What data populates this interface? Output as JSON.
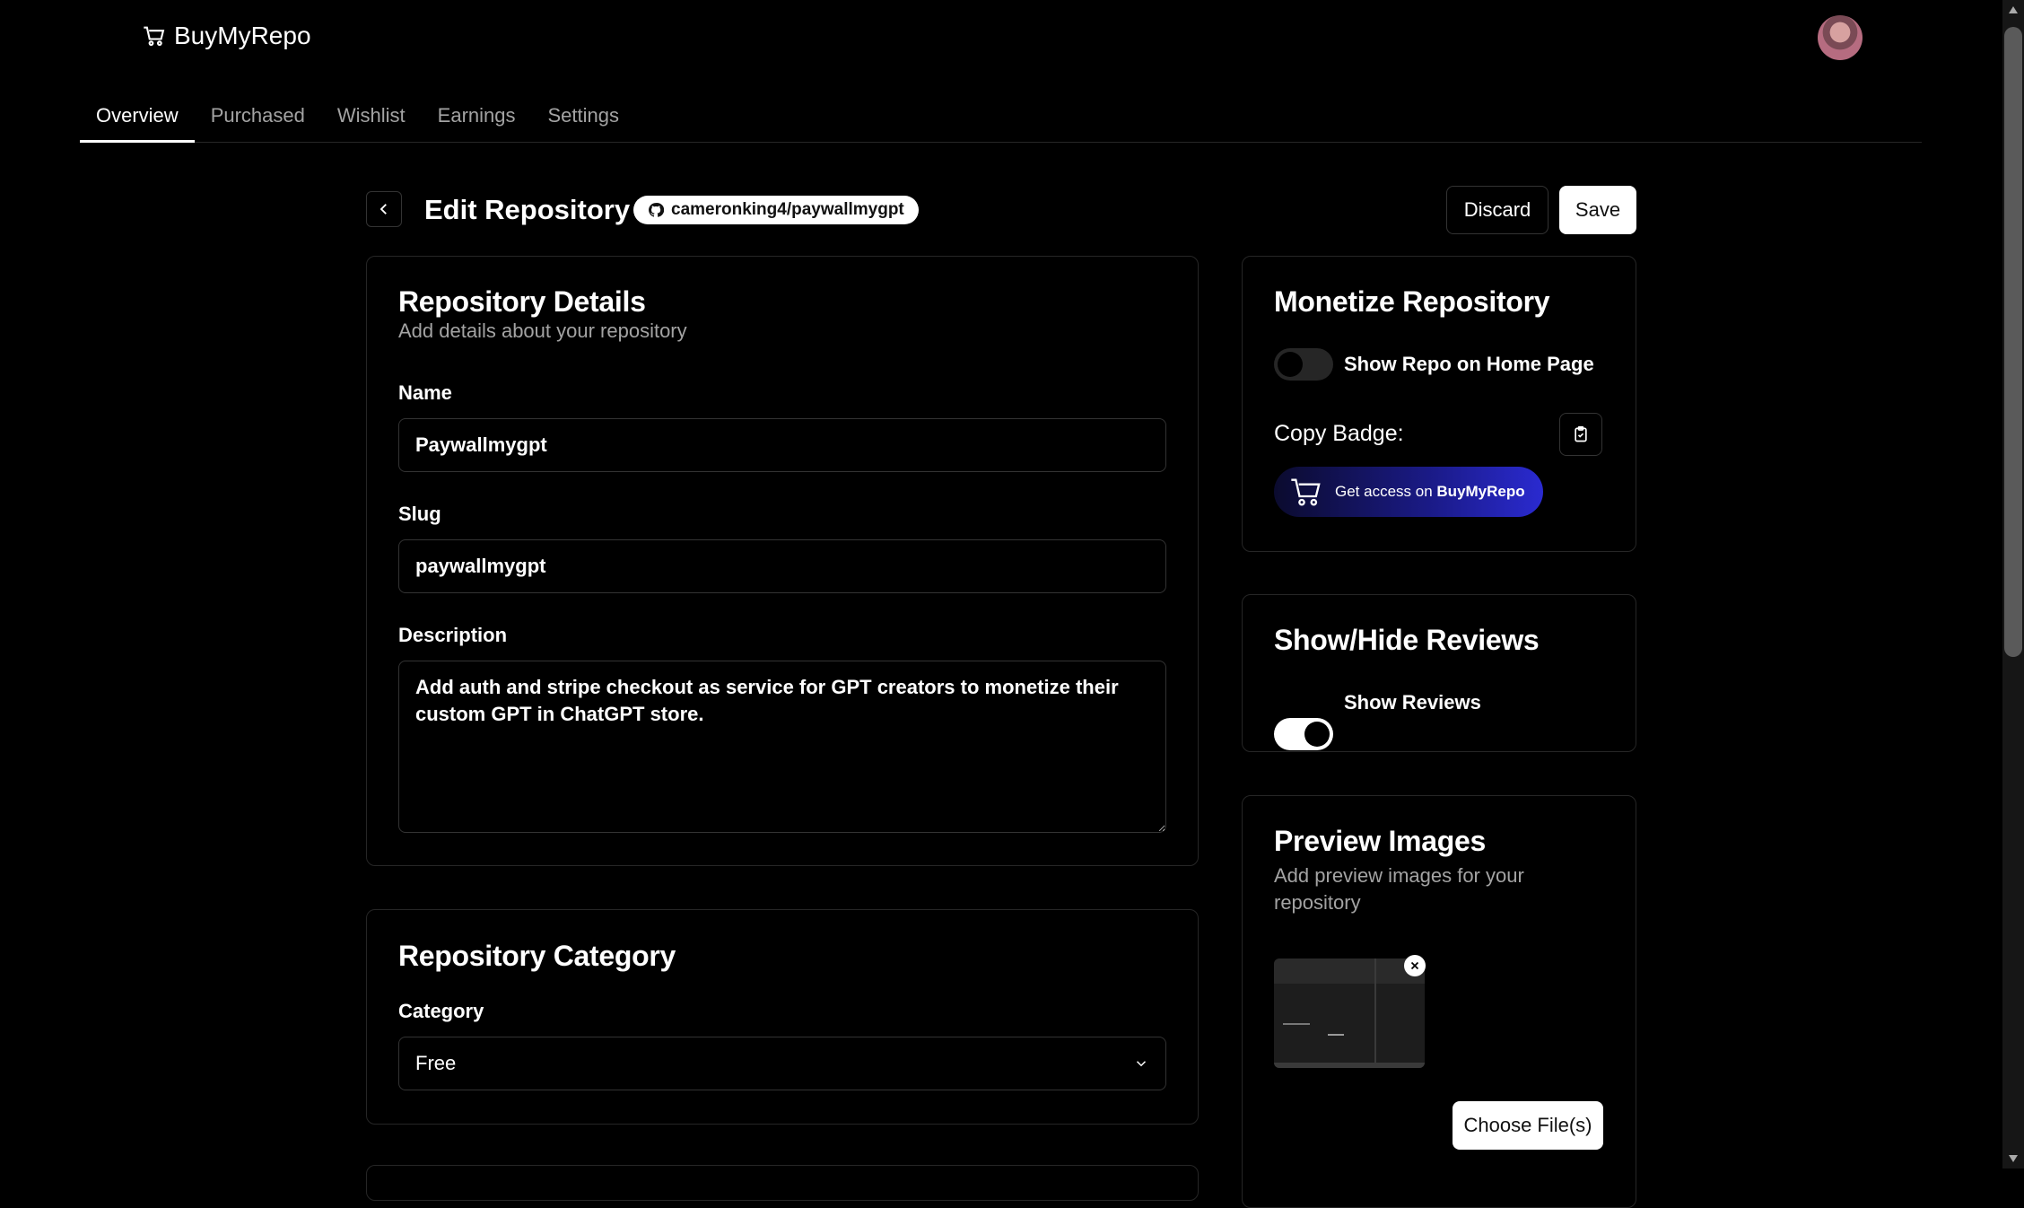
{
  "app": {
    "name": "BuyMyRepo"
  },
  "nav": {
    "tabs": [
      {
        "label": "Overview",
        "active": true
      },
      {
        "label": "Purchased"
      },
      {
        "label": "Wishlist"
      },
      {
        "label": "Earnings"
      },
      {
        "label": "Settings"
      }
    ]
  },
  "header": {
    "title": "Edit Repository",
    "repo_full_name": "cameronking4/paywallmygpt",
    "discard_label": "Discard",
    "save_label": "Save"
  },
  "details": {
    "title": "Repository Details",
    "subtitle": "Add details about your repository",
    "name_label": "Name",
    "name_value": "Paywallmygpt",
    "slug_label": "Slug",
    "slug_value": "paywallmygpt",
    "description_label": "Description",
    "description_value": "Add auth and stripe checkout as service for GPT creators to monetize their custom GPT in ChatGPT store."
  },
  "category": {
    "title": "Repository Category",
    "label": "Category",
    "selected": "Free"
  },
  "monetize": {
    "title": "Monetize Repository",
    "show_home_label": "Show Repo on Home Page",
    "show_home_on": false,
    "copy_badge_label": "Copy Badge:",
    "badge_prefix": "Get access on",
    "badge_brand": "BuyMyRepo"
  },
  "reviews": {
    "title": "Show/Hide Reviews",
    "toggle_label": "Show Reviews",
    "toggle_on": true
  },
  "preview": {
    "title": "Preview Images",
    "subtitle": "Add preview images for your repository",
    "choose_label": "Choose File(s)"
  },
  "colors": {
    "background": "#000000",
    "border": "#262626",
    "muted_text": "#a3a3a3",
    "badge_blue": "#1b1b8a"
  }
}
